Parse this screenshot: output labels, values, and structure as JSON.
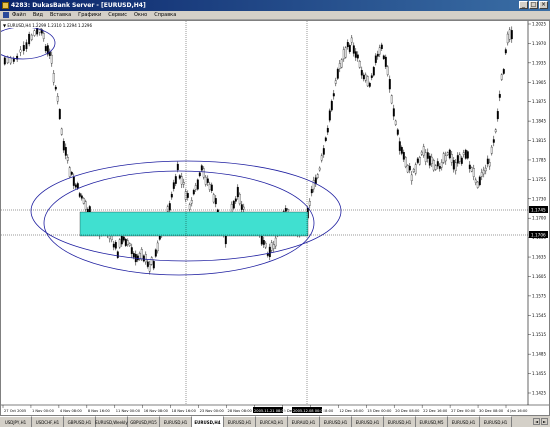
{
  "window": {
    "title": "4283: DukasBank Server - [EURUSD,H4]",
    "min_glyph": "_",
    "max_glyph": "□",
    "close_glyph": "×"
  },
  "menu": [
    "Файл",
    "Вид",
    "Вставка",
    "Графики",
    "Сервис",
    "Окно",
    "Справка"
  ],
  "chart": {
    "ohlc_label": "▼ EURUSD,H4  1.2299 1.2310 1.2294 1.2296",
    "y_labels": [
      "1.2025",
      "1.1970",
      "1.1935",
      "1.1905",
      "1.1875",
      "1.1845",
      "1.1815",
      "1.1785",
      "1.1755",
      "1.1730",
      "1.1700",
      "1.1665",
      "1.1635",
      "1.1605",
      "1.1575",
      "1.1545",
      "1.1515",
      "1.1485",
      "1.1455",
      "1.1425"
    ],
    "y_tag_hline1": "1.1745",
    "y_tag_hline2": "1.1706",
    "x_labels": [
      "27 Oct 2005",
      "1 Nov 00:00",
      "4 Nov 08:00",
      "8 Nov 16:00",
      "11 Nov 00:00",
      "16 Nov 08:00",
      "18 Nov 16:00",
      "23 Nov 00:00",
      "28 Nov 08:00",
      "30 Nov 16:00",
      "5 Dec 00:00",
      "8 Dec 08:00",
      "12 Dec 16:00",
      "15 Dec 00:00",
      "20 Dec 08:00",
      "22 Dec 16:00",
      "27 Dec 00:00",
      "30 Dec 08:00",
      "4 Jan 16:00"
    ],
    "x_tag_vline1": "2005.11.21 08:00",
    "x_tag_vline2": "2005.12.08 00:00",
    "colors": {
      "candle": "#000000",
      "ellipse": "#1e1ea0",
      "rectangle": "#40e0d0",
      "grid": "#000000"
    }
  },
  "tabs": [
    "USDJPY,H1",
    "USDCHF,H1",
    "GBPUSD,H1",
    "EURUSD,Weekly",
    "GBPUSD,M15",
    "EURUSD,H1",
    "EURUSD,H4",
    "EURUSD,H1",
    "EURCAD,H1",
    "EURAUD,H1",
    "EURUSD,H1",
    "EURUSD,H1",
    "EURUSD,H1",
    "EURUSD,M5",
    "EURUSD,H1",
    "EURUSD,H1"
  ],
  "active_tab_index": 6,
  "tab_scroll": {
    "left": "◄",
    "right": "►"
  }
}
